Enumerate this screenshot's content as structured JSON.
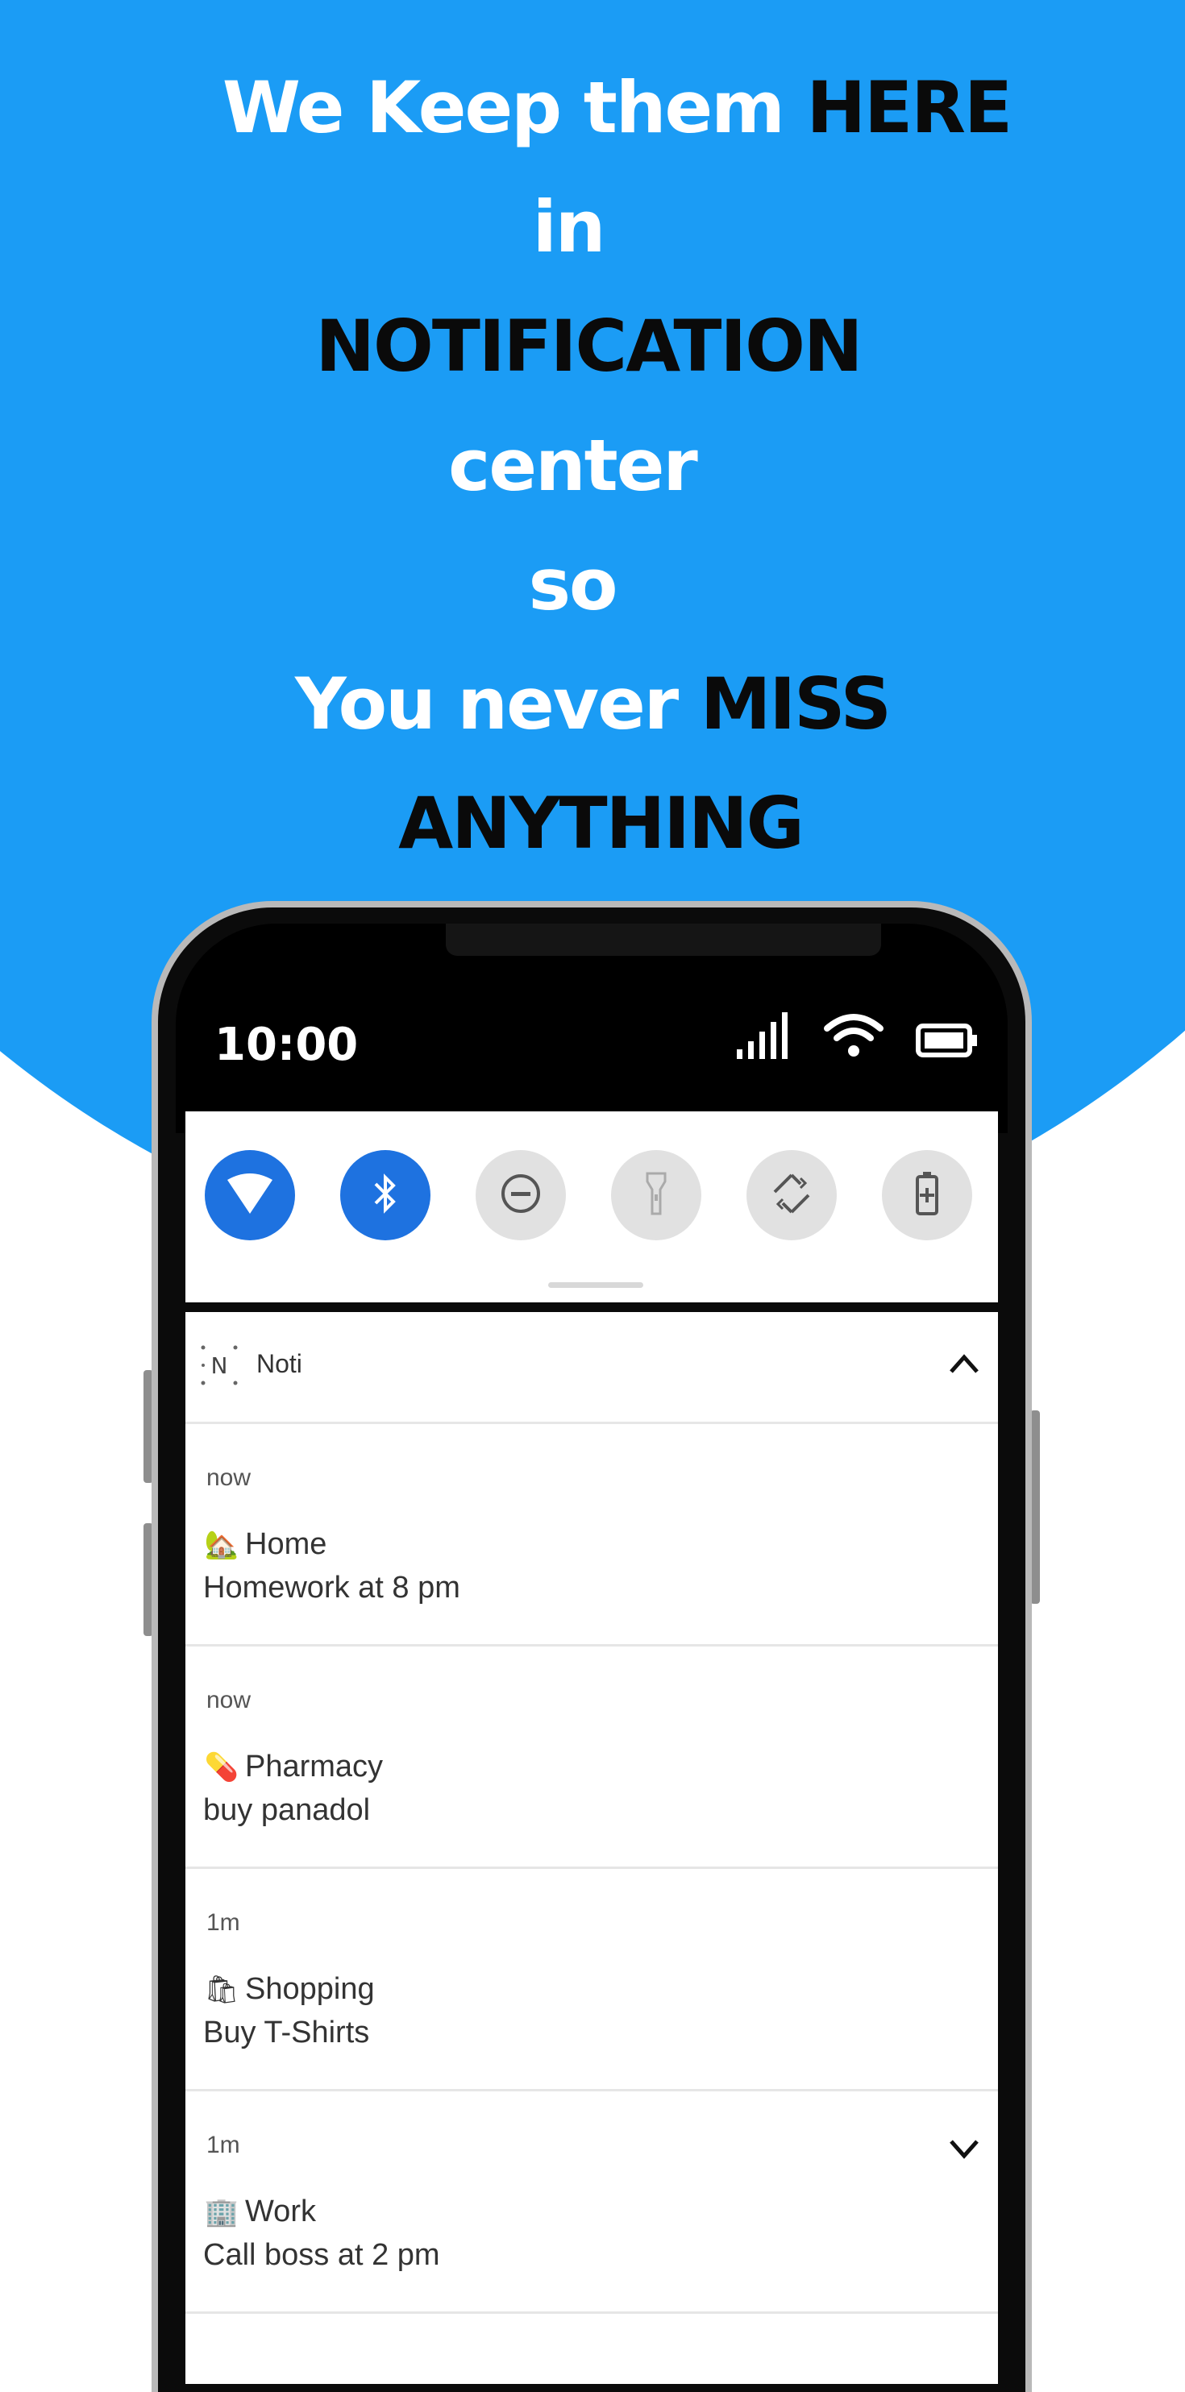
{
  "headline": {
    "line1_white": "We Keep them ",
    "line1_black": "HERE",
    "line2_white": "in",
    "line3_black": "NOTIFICATION",
    "line4_white": "center",
    "line5_white": "so",
    "line6_white": "You never ",
    "line6_black": "MISS",
    "line7_black": "ANYTHING"
  },
  "colors": {
    "background_blue": "#1b9cf5",
    "toggle_on": "#1e72e0",
    "toggle_off": "#e1e1e1"
  },
  "status_bar": {
    "time": "10:00",
    "icons": [
      "signal-icon",
      "wifi-icon",
      "battery-icon"
    ]
  },
  "quick_settings": [
    {
      "name": "wifi",
      "icon": "wifi-icon",
      "state": "on"
    },
    {
      "name": "bluetooth",
      "icon": "bluetooth-icon",
      "state": "on"
    },
    {
      "name": "do-not-disturb",
      "icon": "do-not-disturb-icon",
      "state": "off"
    },
    {
      "name": "flashlight",
      "icon": "flashlight-icon",
      "state": "off"
    },
    {
      "name": "auto-rotate",
      "icon": "rotate-icon",
      "state": "off"
    },
    {
      "name": "battery-saver",
      "icon": "battery-saver-icon",
      "state": "off"
    }
  ],
  "notification_group": {
    "app_logo": "N",
    "app_name": "Noti",
    "collapse_icon": "chevron-up-icon"
  },
  "notifications": [
    {
      "time": "now",
      "emoji": "🏡",
      "emoji_name": "house-icon",
      "title": "Home",
      "body": "Homework at 8 pm"
    },
    {
      "time": "now",
      "emoji": "💊",
      "emoji_name": "pill-icon",
      "title": "Pharmacy",
      "body": "buy panadol"
    },
    {
      "time": "1m",
      "emoji": "🛍",
      "emoji_name": "shopping-bags-icon",
      "title": "Shopping",
      "body": "Buy T-Shirts"
    },
    {
      "time": "1m",
      "emoji": "🏢",
      "emoji_name": "office-building-icon",
      "title": "Work",
      "body": "Call boss at 2 pm",
      "expand_icon": "chevron-down-icon"
    }
  ]
}
